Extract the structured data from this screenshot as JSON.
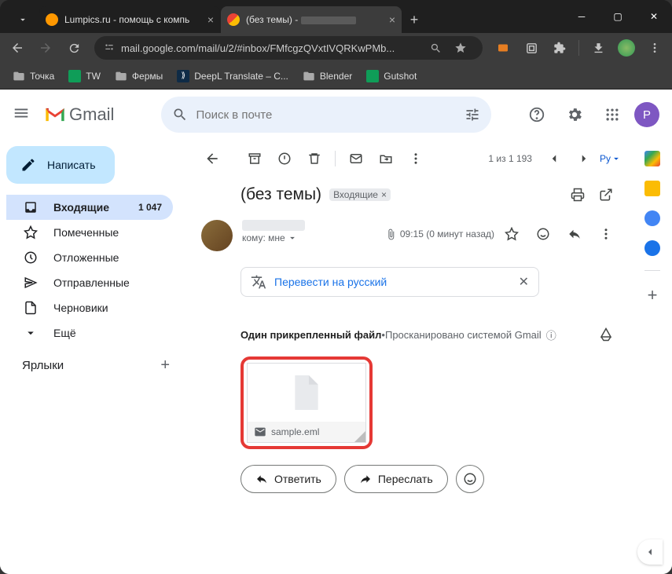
{
  "browser": {
    "tabs": [
      {
        "title": "Lumpics.ru - помощь с компь",
        "favColor": "#ff9800"
      },
      {
        "title": "(без темы) -",
        "favColor": "#ea4335"
      }
    ],
    "url": "mail.google.com/mail/u/2/#inbox/FMfcgzQVxtIVQRKwPMb...",
    "bookmarks": [
      "Точка",
      "TW",
      "Фермы",
      "DeepL Translate – С...",
      "Blender",
      "Gutshot"
    ]
  },
  "gmail": {
    "logo_text": "Gmail",
    "search_placeholder": "Поиск в почте",
    "avatar_letter": "P",
    "compose": "Написать",
    "nav": [
      {
        "label": "Входящие",
        "count": "1 047"
      },
      {
        "label": "Помеченные"
      },
      {
        "label": "Отложенные"
      },
      {
        "label": "Отправленные"
      },
      {
        "label": "Черновики"
      },
      {
        "label": "Ещё"
      }
    ],
    "labels_header": "Ярлыки",
    "counter": "1 из 1 193",
    "lang_chip": "Ру",
    "subject": "(без темы)",
    "subject_chip": "Входящие",
    "to_text": "кому: мне",
    "time": "09:15 (0 минут назад)",
    "translate": "Перевести на русский",
    "attach_title": "Один прикрепленный файл",
    "attach_sep": " • ",
    "attach_scanned": "Просканировано системой Gmail",
    "attach_file": "sample.eml",
    "reply": "Ответить",
    "forward": "Переслать"
  }
}
